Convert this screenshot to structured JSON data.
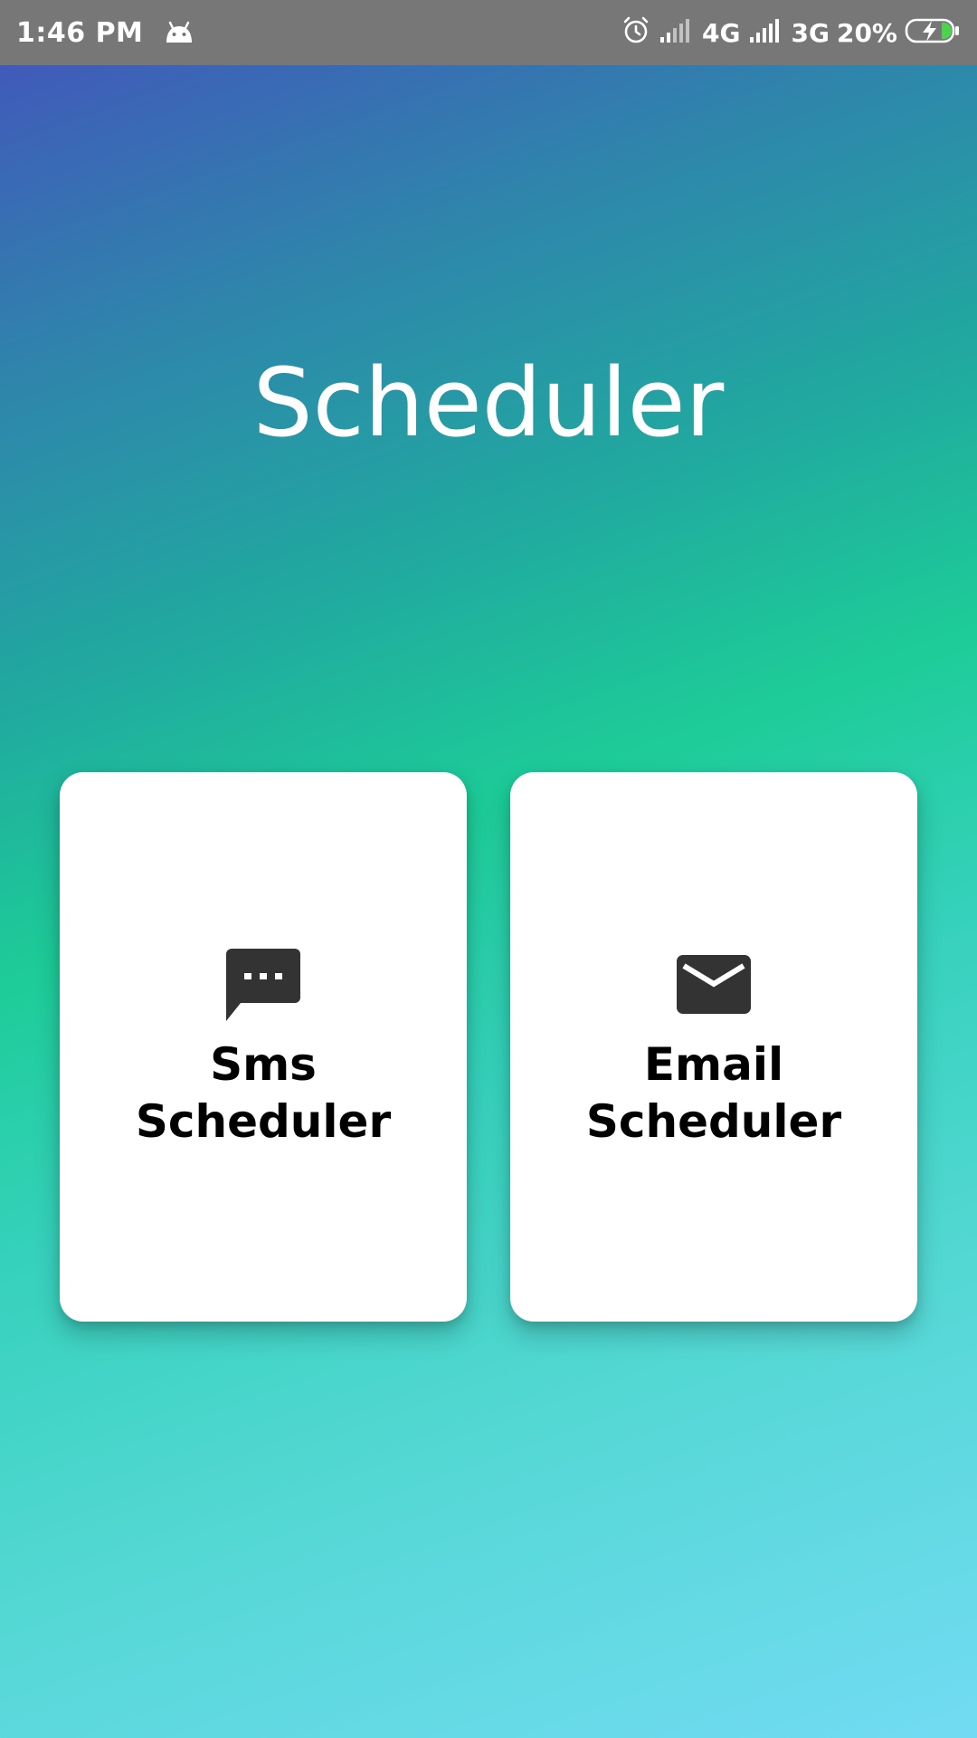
{
  "status_bar": {
    "time": "1:46 PM",
    "network_1": "4G",
    "network_2": "3G",
    "battery_percent": "20%",
    "icons": [
      "android-icon",
      "alarm-icon",
      "signal-icon",
      "signal-icon",
      "battery-charging-icon"
    ]
  },
  "app": {
    "title": "Scheduler"
  },
  "cards": {
    "sms": {
      "line1": "Sms",
      "line2": "Scheduler",
      "icon": "sms-icon"
    },
    "email": {
      "line1": "Email",
      "line2": "Scheduler",
      "icon": "email-icon"
    }
  },
  "colors": {
    "status_bar": "#777777",
    "gradient_top": "#4451bd",
    "gradient_mid": "#1dcc98",
    "gradient_bottom": "#72dbf3",
    "card": "#ffffff",
    "icon": "#333333"
  }
}
